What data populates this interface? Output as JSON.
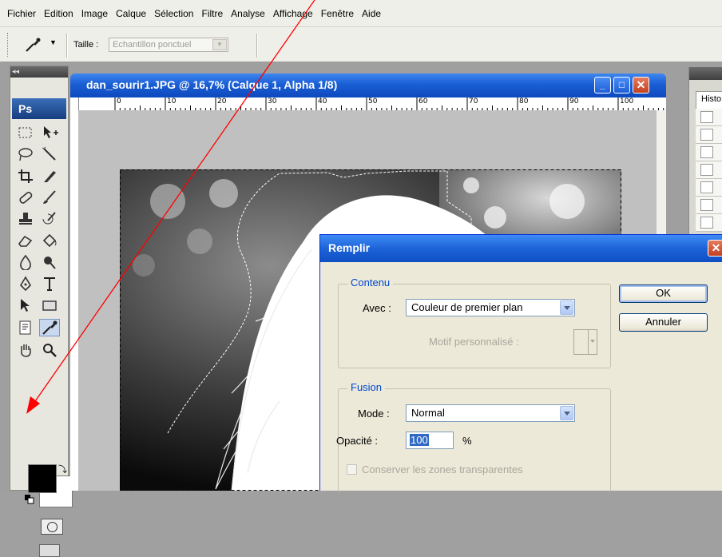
{
  "menubar": {
    "items": [
      "Fichier",
      "Edition",
      "Image",
      "Calque",
      "Sélection",
      "Filtre",
      "Analyse",
      "Affichage",
      "Fenêtre",
      "Aide"
    ]
  },
  "options_bar": {
    "size_label": "Taille :",
    "size_value": "Echantillon ponctuel"
  },
  "toolbox": {
    "collapse_glyph": "◂◂",
    "logo": "Ps",
    "foreground_color": "#000000",
    "background_color": "#ffffff"
  },
  "document": {
    "title": "dan_sourir1.JPG @ 16,7% (Calque 1, Alpha 1/8)",
    "ruler_labels": [
      "0",
      "10",
      "20",
      "30",
      "40",
      "50",
      "60",
      "70",
      "80",
      "90",
      "100"
    ]
  },
  "right_panel": {
    "tab_label": "Histo"
  },
  "dialog": {
    "title": "Remplir",
    "contenu": {
      "legend": "Contenu",
      "avec_label": "Avec :",
      "avec_value": "Couleur de premier plan",
      "motif_label": "Motif personnalisé :"
    },
    "fusion": {
      "legend": "Fusion",
      "mode_label": "Mode :",
      "mode_value": "Normal",
      "opacity_label": "Opacité :",
      "opacity_value": "100",
      "opacity_unit": "%",
      "preserve_label": "Conserver les zones transparentes"
    },
    "ok_label": "OK",
    "cancel_label": "Annuler"
  },
  "colors": {
    "xp_title_blue": "#1a5ed4",
    "dialog_face": "#ece9d8",
    "group_legend": "#0046d5",
    "annotation_arrow": "#ff0000"
  }
}
